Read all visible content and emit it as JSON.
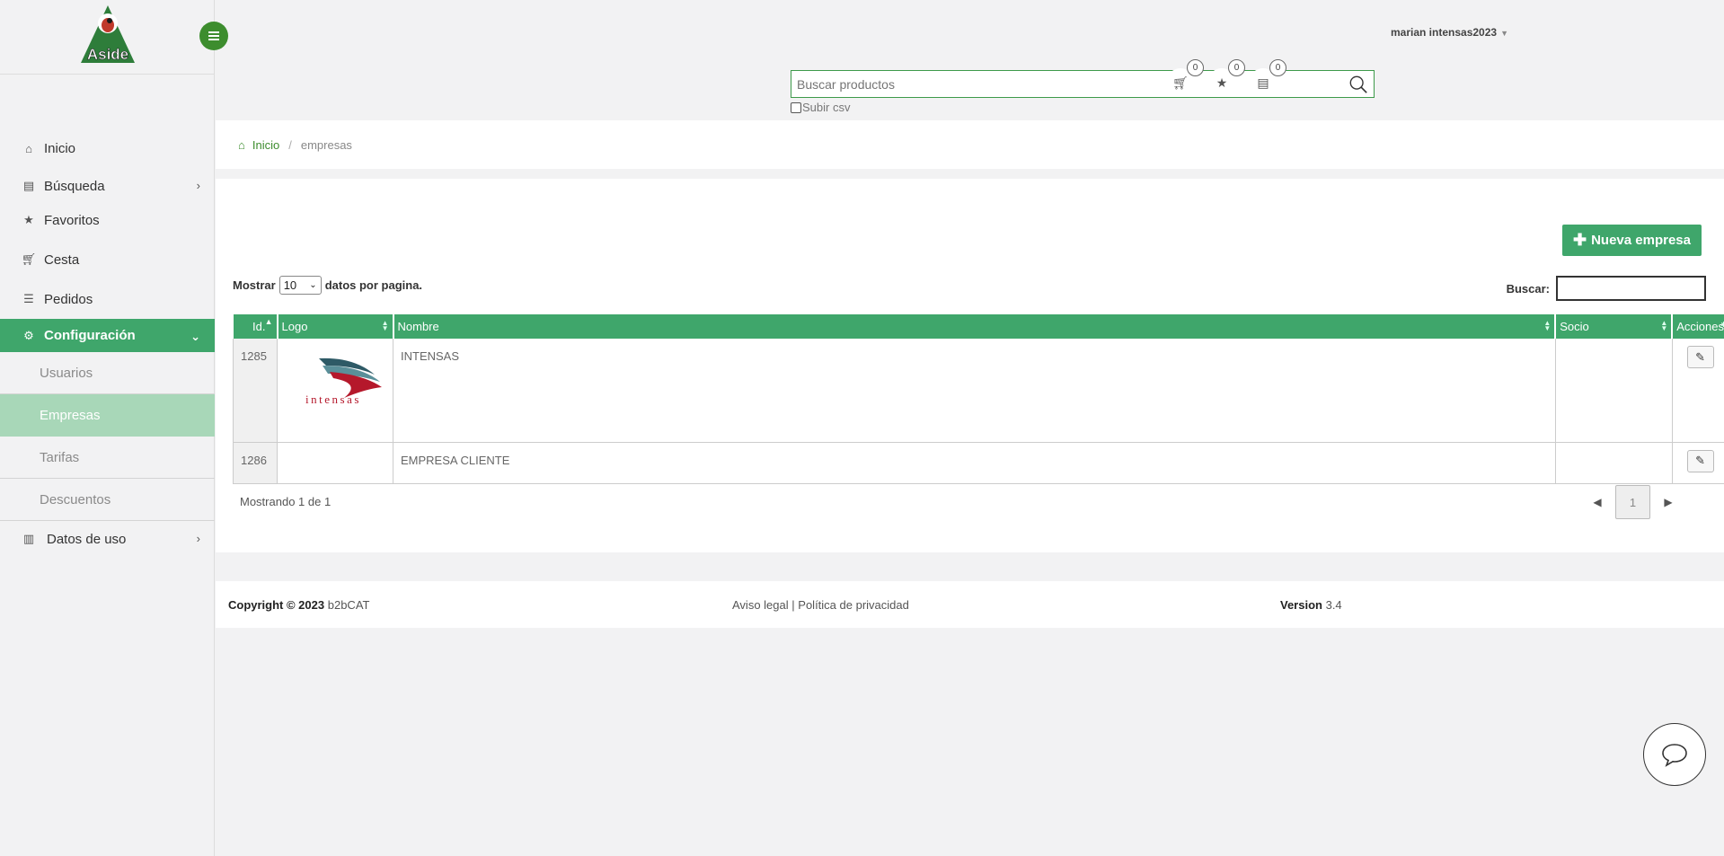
{
  "header": {
    "user_name": "marian intensas2023",
    "search_placeholder": "Buscar productos",
    "csv_label": "Subir csv",
    "cart_count": "0",
    "favorites_count": "0",
    "orders_count": "0"
  },
  "sidebar": {
    "logo_text": "Aside",
    "items": [
      {
        "label": "Inicio",
        "icon": "home-icon"
      },
      {
        "label": "Búsqueda",
        "icon": "book-icon"
      },
      {
        "label": "Favoritos",
        "icon": "star-icon"
      },
      {
        "label": "Cesta",
        "icon": "cart-icon"
      },
      {
        "label": "Pedidos",
        "icon": "list-icon"
      },
      {
        "label": "Configuración",
        "icon": "cogs-icon"
      }
    ],
    "sub_items": [
      "Usuarios",
      "Empresas",
      "Tarifas",
      "Descuentos"
    ],
    "last_item": {
      "label": "Datos de uso",
      "icon": "bar-chart-icon"
    }
  },
  "breadcrumb": {
    "home": "Inicio",
    "sep": "/",
    "current": "empresas"
  },
  "main": {
    "new_button": "Nueva empresa",
    "show_prefix": "Mostrar",
    "show_value": "10",
    "show_suffix": "datos por pagina.",
    "search_label": "Buscar:",
    "columns": [
      "Id.",
      "Logo",
      "Nombre",
      "Socio",
      "Acciones"
    ],
    "rows": [
      {
        "id": "1285",
        "logo": "intensas",
        "name": "INTENSAS",
        "socio": ""
      },
      {
        "id": "1286",
        "logo": "",
        "name": "EMPRESA CLIENTE",
        "socio": ""
      }
    ],
    "showing": "Mostrando 1 de 1",
    "page": "1"
  },
  "footer": {
    "copyright_prefix": "Copyright © 2023",
    "brand": "b2bCAT",
    "legal": "Aviso legal",
    "divider": "|",
    "privacy": "Política de privacidad",
    "version_label": "Version",
    "version": "3.4"
  },
  "colors": {
    "accent": "#3fa66b",
    "dark_green": "#3d8d2e",
    "logo_red": "#b5182b"
  }
}
